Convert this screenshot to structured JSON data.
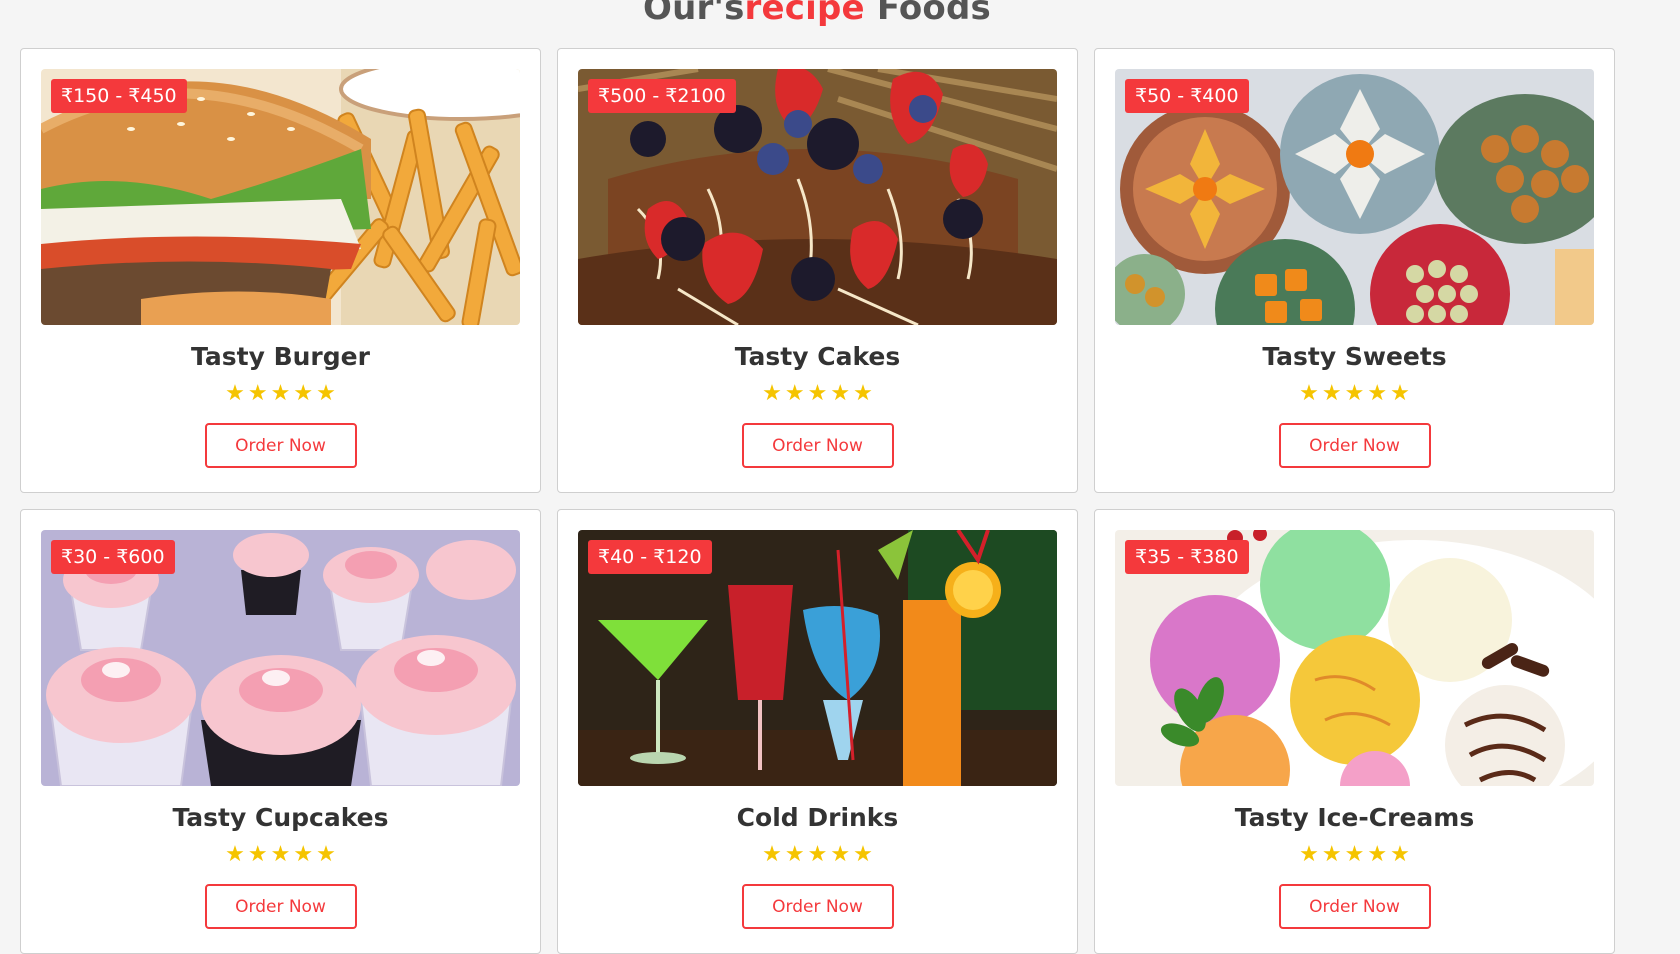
{
  "header": {
    "title_prefix": "Our's",
    "title_accent": "recipe",
    "title_suffix": " Foods"
  },
  "colors": {
    "accent": "#f4393c",
    "star": "#f5c400"
  },
  "cards": [
    {
      "price": "₹150 - ₹450",
      "title": "Tasty Burger",
      "rating": 5,
      "button": "Order Now",
      "image": "burger-fries"
    },
    {
      "price": "₹500 - ₹2100",
      "title": "Tasty Cakes",
      "rating": 5,
      "button": "Order Now",
      "image": "berry-chocolate-cake"
    },
    {
      "price": "₹50 - ₹400",
      "title": "Tasty Sweets",
      "rating": 5,
      "button": "Order Now",
      "image": "indian-sweets-platter"
    },
    {
      "price": "₹30 - ₹600",
      "title": "Tasty Cupcakes",
      "rating": 5,
      "button": "Order Now",
      "image": "pink-cupcakes"
    },
    {
      "price": "₹40 - ₹120",
      "title": "Cold Drinks",
      "rating": 5,
      "button": "Order Now",
      "image": "colorful-drinks"
    },
    {
      "price": "₹35 - ₹380",
      "title": "Tasty Ice-Creams",
      "rating": 5,
      "button": "Order Now",
      "image": "ice-cream-scoops"
    }
  ]
}
